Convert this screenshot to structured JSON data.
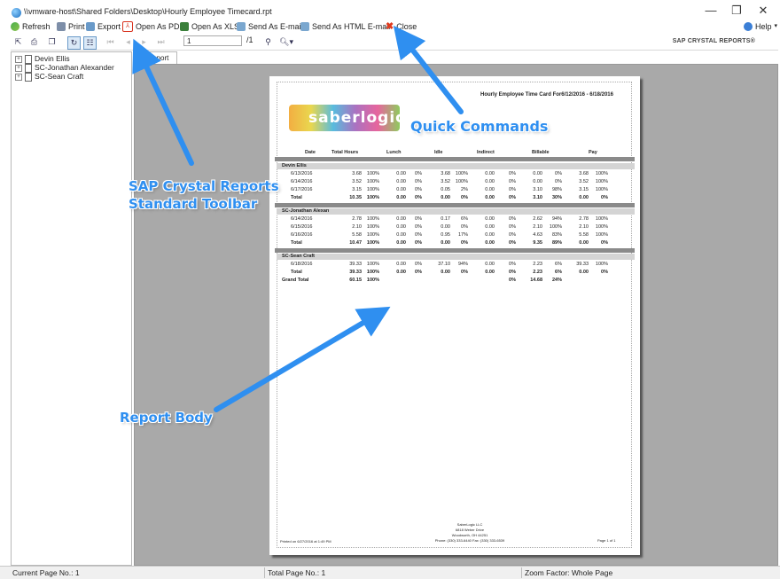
{
  "window": {
    "title": "\\\\vmware-host\\Shared Folders\\Desktop\\Hourly Employee Timecard.rpt",
    "minimize": "—",
    "restore": "❐",
    "close": "✕"
  },
  "menu": {
    "refresh": "Refresh",
    "print": "Print",
    "export": "Export",
    "open_pdf": "Open As PDF",
    "open_xls": "Open As XLS",
    "send_email": "Send As E-mail",
    "send_html_email": "Send As HTML E-mail",
    "close": "Close",
    "help": "Help"
  },
  "toolbar": {
    "page_value": "1",
    "page_total": "/1",
    "brand": "SAP CRYSTAL REPORTS®"
  },
  "tree": {
    "items": [
      "Devin Ellis",
      "SC-Jonathan Alexander",
      "SC-Sean Craft"
    ]
  },
  "tab": {
    "label": "e Report"
  },
  "report": {
    "title": "Hourly Employee Time Card For6/12/2016  -  6/18/2016",
    "logo_text": "saberlogic",
    "headers": [
      "Date",
      "Total Hours",
      "Lunch",
      "Idle",
      "Indirect",
      "Billable",
      "Pay"
    ],
    "groups": [
      {
        "name": "Devin Ellis",
        "rows": [
          [
            "6/13/2016",
            "3.68",
            "100%",
            "0.00",
            "0%",
            "3.68",
            "100%",
            "0.00",
            "0%",
            "0.00",
            "0%",
            "3.68",
            "100%"
          ],
          [
            "6/14/2016",
            "3.52",
            "100%",
            "0.00",
            "0%",
            "3.52",
            "100%",
            "0.00",
            "0%",
            "0.00",
            "0%",
            "3.52",
            "100%"
          ],
          [
            "6/17/2016",
            "3.15",
            "100%",
            "0.00",
            "0%",
            "0.05",
            "2%",
            "0.00",
            "0%",
            "3.10",
            "98%",
            "3.15",
            "100%"
          ]
        ],
        "total": [
          "Total",
          "10.35",
          "100%",
          "0.00",
          "0%",
          "0.00",
          "0%",
          "0.00",
          "0%",
          "3.10",
          "30%",
          "0.00",
          "0%"
        ]
      },
      {
        "name": "SC-Jonathan Alexan",
        "rows": [
          [
            "6/14/2016",
            "2.78",
            "100%",
            "0.00",
            "0%",
            "0.17",
            "6%",
            "0.00",
            "0%",
            "2.62",
            "94%",
            "2.78",
            "100%"
          ],
          [
            "6/15/2016",
            "2.10",
            "100%",
            "0.00",
            "0%",
            "0.00",
            "0%",
            "0.00",
            "0%",
            "2.10",
            "100%",
            "2.10",
            "100%"
          ],
          [
            "6/16/2016",
            "5.58",
            "100%",
            "0.00",
            "0%",
            "0.95",
            "17%",
            "0.00",
            "0%",
            "4.63",
            "83%",
            "5.58",
            "100%"
          ]
        ],
        "total": [
          "Total",
          "10.47",
          "100%",
          "0.00",
          "0%",
          "0.00",
          "0%",
          "0.00",
          "0%",
          "9.35",
          "89%",
          "0.00",
          "0%"
        ]
      },
      {
        "name": "SC-Sean Craft",
        "rows": [
          [
            "6/18/2016",
            "39.33",
            "100%",
            "0.00",
            "0%",
            "37.10",
            "94%",
            "0.00",
            "0%",
            "2.23",
            "6%",
            "39.33",
            "100%"
          ]
        ],
        "total": [
          "Total",
          "39.33",
          "100%",
          "0.00",
          "0%",
          "0.00",
          "0%",
          "0.00",
          "0%",
          "2.23",
          "6%",
          "0.00",
          "0%"
        ]
      }
    ],
    "grand_total": [
      "Grand Total",
      "60.15",
      "100%",
      "",
      "",
      "",
      "",
      "",
      "0%",
      "14.68",
      "24%",
      "",
      ""
    ],
    "footer_printed": "Printed on 6/27/2016 at 1:49 PM",
    "footer_company": "SaberLogic LLC",
    "footer_address1": "6818 Weber Drive",
    "footer_address2": "Woodworth, OH 44251",
    "footer_phone": "Phone: (330) 333-6440   Fax: (330) 333-6539",
    "footer_page": "Page 1 of 1"
  },
  "callouts": {
    "quick_commands": "Quick Commands",
    "toolbar_line1": "SAP Crystal Reports",
    "toolbar_line2": "Standard Toolbar",
    "report_body": "Report Body"
  },
  "status": {
    "current": "Current Page No.: 1",
    "total": "Total Page No.: 1",
    "zoom": "Zoom Factor: Whole Page"
  },
  "colors": {
    "callout": "#2f8ff0",
    "arrow": "#2f8ff0",
    "close_x": "#e03a1e",
    "viewer_bg": "#a9a9a9"
  }
}
